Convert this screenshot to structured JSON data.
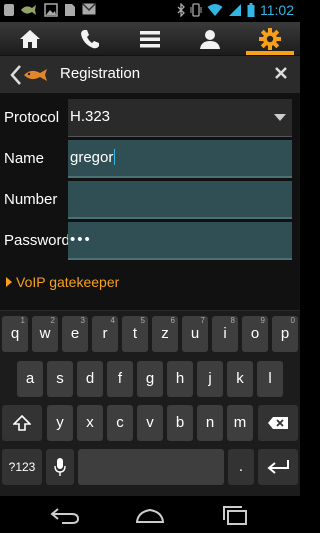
{
  "status_bar": {
    "time": "11:02",
    "icons": [
      "notification-icon",
      "fish-icon",
      "image-icon",
      "file-icon",
      "gmail-icon",
      "bluetooth-icon",
      "vibrate-icon",
      "wifi-icon",
      "signal-icon",
      "battery-icon"
    ]
  },
  "tabs": [
    {
      "name": "home",
      "icon": "home-icon"
    },
    {
      "name": "phone",
      "icon": "phone-icon"
    },
    {
      "name": "list",
      "icon": "list-icon"
    },
    {
      "name": "contacts",
      "icon": "person-icon"
    },
    {
      "name": "settings",
      "icon": "gear-icon",
      "active": true
    }
  ],
  "header": {
    "title": "Registration"
  },
  "form": {
    "protocol_label": "Protocol",
    "protocol_value": "H.323",
    "name_label": "Name",
    "name_value": "gregor",
    "number_label": "Number",
    "number_value": "",
    "password_label": "Password",
    "password_value": "•••",
    "voip_link": "VoIP gatekeeper"
  },
  "keyboard": {
    "row1": [
      "q",
      "w",
      "e",
      "r",
      "t",
      "z",
      "u",
      "i",
      "o",
      "p"
    ],
    "row1_alt": [
      "1",
      "2",
      "3",
      "4",
      "5",
      "6",
      "7",
      "8",
      "9",
      "0"
    ],
    "row2": [
      "a",
      "s",
      "d",
      "f",
      "g",
      "h",
      "j",
      "k",
      "l"
    ],
    "row3": [
      "y",
      "x",
      "c",
      "v",
      "b",
      "n",
      "m"
    ],
    "symbols_key": "?123",
    "period_key": "."
  },
  "colors": {
    "accent": "#f8a01a",
    "field_bg": "#2f4f55",
    "clock": "#33b5e5"
  }
}
